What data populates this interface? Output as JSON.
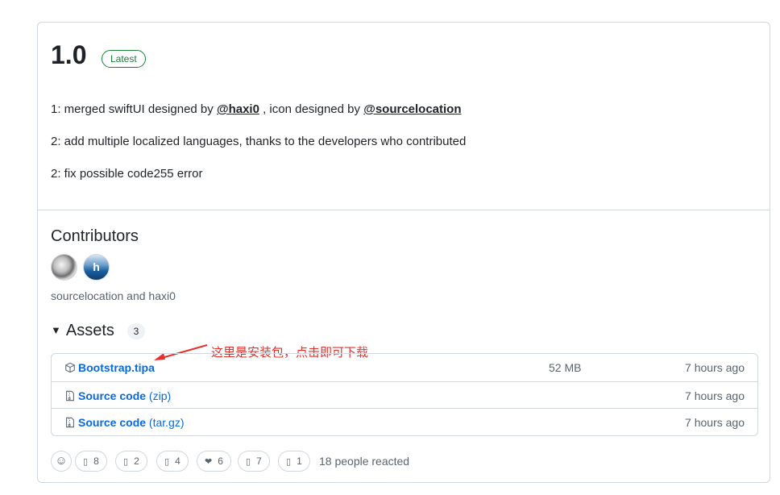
{
  "release": {
    "version": "1.0",
    "badge": "Latest",
    "notes": {
      "line1_prefix": "1: merged swiftUI designed by ",
      "line1_mention1": "@haxi0",
      "line1_middle": " , icon designed by ",
      "line1_mention2": "@sourcelocation",
      "line2": "2: add multiple localized languages, thanks to the developers who contributed",
      "line3": "2: fix possible code255 error"
    }
  },
  "contributors": {
    "title": "Contributors",
    "avatar2_letter": "h",
    "names": "sourcelocation and haxi0"
  },
  "assets": {
    "title": "Assets",
    "count": "3",
    "annotation": "这里是安装包，点击即可下载",
    "items": [
      {
        "name": "Bootstrap.tipa",
        "sub": "",
        "size": "52 MB",
        "time": "7 hours ago",
        "icon": "package-icon"
      },
      {
        "name": "Source code",
        "sub": "(zip)",
        "size": "",
        "time": "7 hours ago",
        "icon": "file-zip-icon"
      },
      {
        "name": "Source code",
        "sub": "(tar.gz)",
        "size": "",
        "time": "7 hours ago",
        "icon": "file-zip-icon"
      }
    ]
  },
  "reactions": {
    "items": [
      {
        "emoji": "▯",
        "count": "8"
      },
      {
        "emoji": "▯",
        "count": "2"
      },
      {
        "emoji": "▯",
        "count": "4"
      },
      {
        "emoji": "❤",
        "count": "6"
      },
      {
        "emoji": "▯",
        "count": "7"
      },
      {
        "emoji": "▯",
        "count": "1"
      }
    ],
    "summary": "18 people reacted"
  },
  "colors": {
    "link": "#0969da",
    "latest": "#1a7f37",
    "annotation": "#e5312a",
    "border": "#d0d7de"
  }
}
